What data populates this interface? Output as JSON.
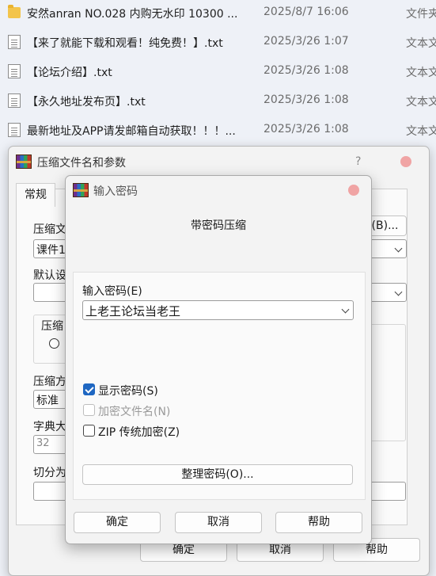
{
  "files": [
    {
      "icon": "folder-icon",
      "name": "安然anran NO.028 内购无水印 10300 ...",
      "date": "2025/8/7 16:06",
      "type": "文件夹"
    },
    {
      "icon": "txt-file-icon",
      "name": "【来了就能下载和观看！纯免费！】.txt",
      "date": "2025/3/26 1:07",
      "type": "文本文档"
    },
    {
      "icon": "txt-file-icon",
      "name": "【论坛介绍】.txt",
      "date": "2025/3/26 1:08",
      "type": "文本文档"
    },
    {
      "icon": "txt-file-icon",
      "name": "【永久地址发布页】.txt",
      "date": "2025/3/26 1:08",
      "type": "文本文档"
    },
    {
      "icon": "txt-file-icon",
      "name": "最新地址及APP请发邮箱自动获取！！！...",
      "date": "2025/3/26 1:08",
      "type": "文本文档"
    }
  ],
  "archive_dialog": {
    "title": "压缩文件名和参数",
    "help": "?",
    "tab_general": "常规",
    "archive_name_label": "压缩文",
    "archive_name_value": "课件1",
    "browse_button": "(B)...",
    "default_profile_label": "默认设",
    "format_group_label": "压缩",
    "method_label": "压缩方",
    "method_value": "标准",
    "dict_label": "字典大",
    "dict_value": "32",
    "split_label": "切分为",
    "ok": "确定",
    "cancel": "取消",
    "help_button": "帮助"
  },
  "password_dialog": {
    "title": "输入密码",
    "subtitle": "带密码压缩",
    "password_label": "输入密码(E)",
    "password_value": "上老王论坛当老王",
    "show_password": "显示密码(S)",
    "encrypt_names": "加密文件名(N)",
    "zip_legacy": "ZIP 传统加密(Z)",
    "organize_button": "整理密码(O)...",
    "ok": "确定",
    "cancel": "取消",
    "help_button": "帮助"
  },
  "colors": {
    "accent": "#1f67c2",
    "close": "#f0a4a4"
  }
}
